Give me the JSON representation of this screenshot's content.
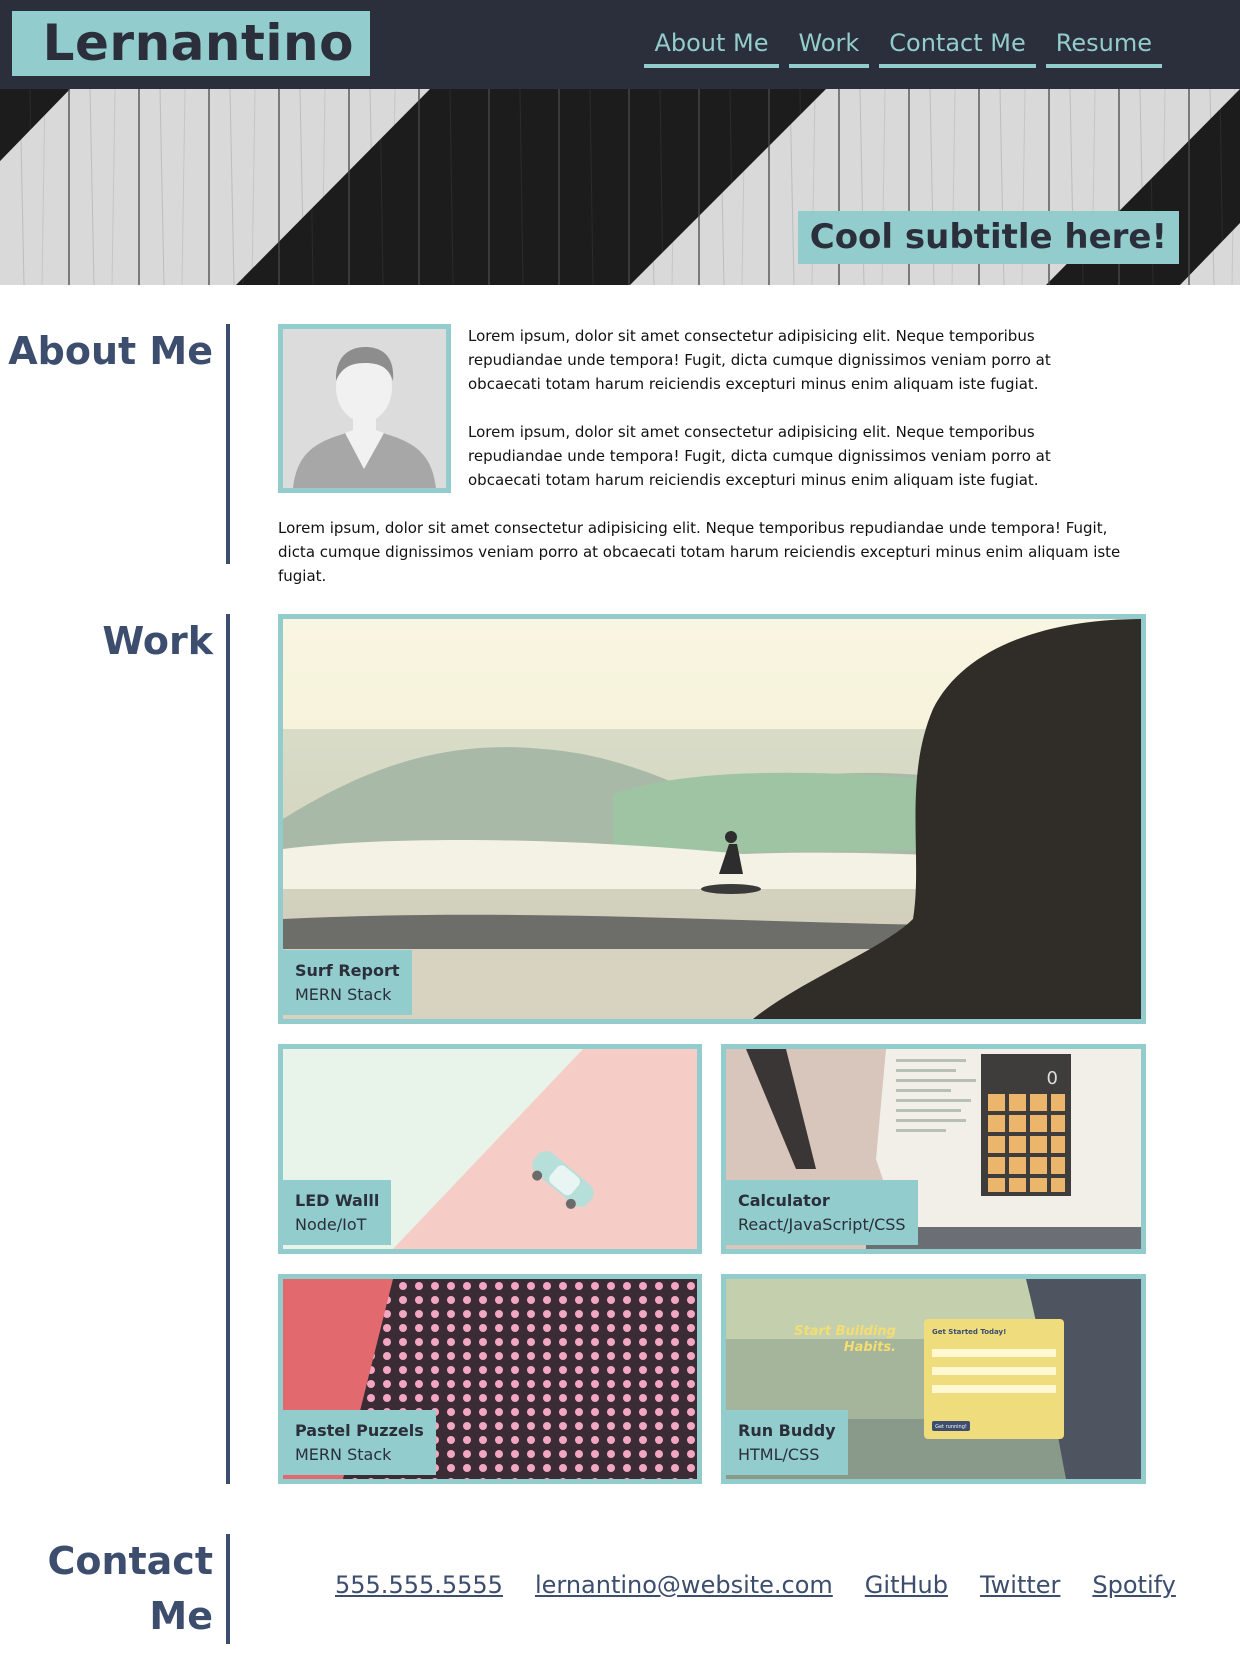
{
  "header": {
    "logo": "Lernantino",
    "nav": [
      "About Me",
      "Work",
      "Contact Me",
      "Resume"
    ]
  },
  "hero": {
    "subtitle": "Cool subtitle here!"
  },
  "about": {
    "title": "About Me",
    "paragraphs": [
      "Lorem ipsum, dolor sit amet consectetur adipisicing elit. Neque temporibus repudiandae unde tempora! Fugit, dicta cumque dignissimos veniam porro at obcaecati totam harum reiciendis excepturi minus enim aliquam iste fugiat.",
      "Lorem ipsum, dolor sit amet consectetur adipisicing elit. Neque temporibus repudiandae unde tempora! Fugit, dicta cumque dignissimos veniam porro at obcaecati totam harum reiciendis excepturi minus enim aliquam iste fugiat.",
      "Lorem ipsum, dolor sit amet consectetur adipisicing elit. Neque temporibus repudiandae unde tempora! Fugit, dicta cumque dignissimos veniam porro at obcaecati totam harum reiciendis excepturi minus enim aliquam iste fugiat."
    ]
  },
  "work": {
    "title": "Work",
    "projects": [
      {
        "title": "Surf Report",
        "stack": "MERN Stack"
      },
      {
        "title": "LED Walll",
        "stack": "Node/IoT"
      },
      {
        "title": "Calculator",
        "stack": "React/JavaScript/CSS"
      },
      {
        "title": "Pastel Puzzels",
        "stack": "MERN Stack"
      },
      {
        "title": "Run Buddy",
        "stack": "HTML/CSS"
      }
    ]
  },
  "contact": {
    "title_line1": "Contact",
    "title_line2": "Me",
    "links": [
      "555.555.5555",
      "lernantino@website.com",
      "GitHub",
      "Twitter",
      "Spotify"
    ]
  },
  "calculator_display": "0",
  "runbuddy_preview": {
    "headline_1": "Start Building",
    "headline_2": "Habits.",
    "form_title": "Get Started Today!",
    "form_button": "Get running!"
  },
  "colors": {
    "navy": "#2b2e3b",
    "teal": "#92cccc",
    "heading_blue": "#3c4d6e"
  }
}
